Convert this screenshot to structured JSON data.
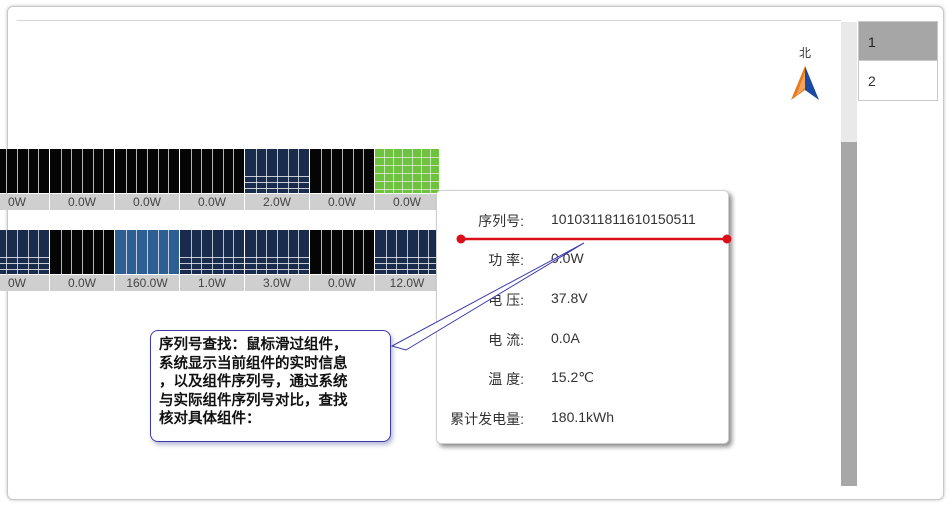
{
  "compass": {
    "label": "北",
    "icon": "north-arrow-icon"
  },
  "pager": {
    "pages": [
      "1",
      "2"
    ],
    "active": "1"
  },
  "panels_row1": [
    {
      "value": "0W",
      "style": "black"
    },
    {
      "value": "0.0W",
      "style": "black"
    },
    {
      "value": "0.0W",
      "style": "black"
    },
    {
      "value": "0.0W",
      "style": "black"
    },
    {
      "value": "2.0W",
      "style": "navy"
    },
    {
      "value": "0.0W",
      "style": "black"
    },
    {
      "value": "0.0W",
      "style": "green"
    }
  ],
  "panels_row2": [
    {
      "value": "0W",
      "style": "navy"
    },
    {
      "value": "0.0W",
      "style": "black"
    },
    {
      "value": "160.0W",
      "style": "blue"
    },
    {
      "value": "1.0W",
      "style": "navy"
    },
    {
      "value": "3.0W",
      "style": "navy"
    },
    {
      "value": "0.0W",
      "style": "black"
    },
    {
      "value": "12.0W",
      "style": "navy"
    }
  ],
  "tooltip": {
    "rows": [
      {
        "key": "序列号:",
        "value": "1010311811610150511"
      },
      {
        "key": "功 率:",
        "value": "0.0W"
      },
      {
        "key": "电 压:",
        "value": "37.8V"
      },
      {
        "key": "电 流:",
        "value": "0.0A"
      },
      {
        "key": "温 度:",
        "value": "15.2℃"
      },
      {
        "key": "累计发电量:",
        "value": "180.1kWh"
      }
    ]
  },
  "callout": {
    "lines": [
      "序列号查找：鼠标滑过组件，",
      "系统显示当前组件的实时信息",
      "，以及组件序列号，通过系统",
      "与实际组件序列号对比，查找",
      "核对具体组件："
    ]
  },
  "colors": {
    "highlight_line": "#d9101a",
    "callout_border": "#3b3bb0",
    "scrollbar": "#a7a7a7"
  }
}
